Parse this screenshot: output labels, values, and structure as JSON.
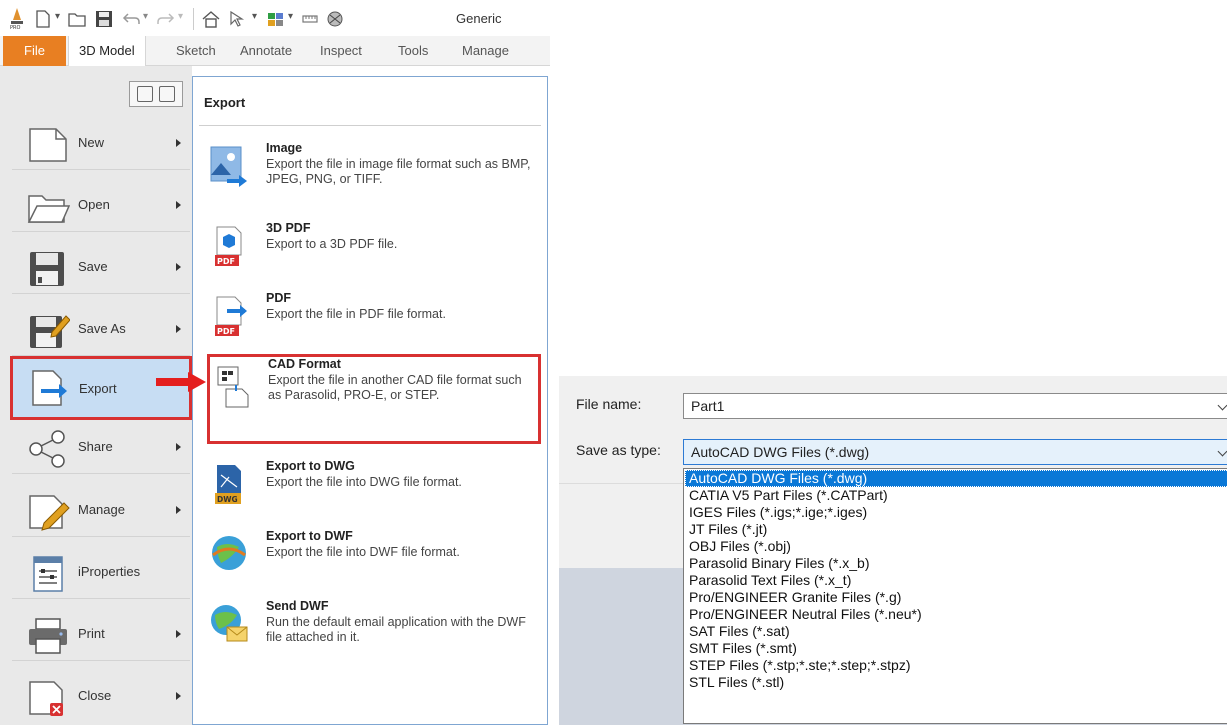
{
  "inventor": {
    "qat_profile": "Generic",
    "ribbon_tabs": [
      "File",
      "3D Model",
      "Sketch",
      "Annotate",
      "Inspect",
      "Tools",
      "Manage"
    ],
    "menu_items": [
      {
        "label": "New",
        "icon": "new-document-icon"
      },
      {
        "label": "Open",
        "icon": "open-folder-icon"
      },
      {
        "label": "Save",
        "icon": "floppy-disk-icon"
      },
      {
        "label": "Save As",
        "icon": "save-as-icon"
      },
      {
        "label": "Export",
        "icon": "export-icon"
      },
      {
        "label": "Share",
        "icon": "share-icon"
      },
      {
        "label": "Manage",
        "icon": "manage-icon"
      },
      {
        "label": "iProperties",
        "icon": "iproperties-icon"
      },
      {
        "label": "Print",
        "icon": "printer-icon"
      },
      {
        "label": "Close",
        "icon": "close-document-icon"
      }
    ],
    "export_panel": {
      "title": "Export",
      "items": [
        {
          "title": "Image",
          "desc": "Export the file in image file format such as BMP, JPEG, PNG, or TIFF.",
          "icon": "image-export-icon"
        },
        {
          "title": "3D PDF",
          "desc": "Export to a 3D PDF file.",
          "icon": "3d-pdf-icon"
        },
        {
          "title": "PDF",
          "desc": "Export the file in PDF file format.",
          "icon": "pdf-icon"
        },
        {
          "title": "CAD Format",
          "desc": "Export the file in another CAD file format such as Parasolid, PRO-E, or STEP.",
          "icon": "cad-format-icon"
        },
        {
          "title": "Export to DWG",
          "desc": "Export the file into DWG file format.",
          "icon": "dwg-icon"
        },
        {
          "title": "Export to DWF",
          "desc": "Export the file into DWF file format.",
          "icon": "dwf-globe-icon"
        },
        {
          "title": "Send DWF",
          "desc": "Run the default email application with the DWF file attached in it.",
          "icon": "send-dwf-icon"
        }
      ]
    },
    "colors": {
      "file_tab": "#e87f22",
      "highlight": "#d83131",
      "selected_bg": "#c7ddf3"
    }
  },
  "dialog": {
    "file_name_label": "File name:",
    "file_name_value": "Part1",
    "save_as_type_label": "Save as type:",
    "save_as_type_value": "AutoCAD DWG Files (*.dwg)",
    "options": [
      "AutoCAD DWG Files (*.dwg)",
      "CATIA V5 Part Files (*.CATPart)",
      "IGES Files (*.igs;*.ige;*.iges)",
      "JT Files (*.jt)",
      "OBJ Files (*.obj)",
      "Parasolid Binary Files (*.x_b)",
      "Parasolid Text Files (*.x_t)",
      "Pro/ENGINEER Granite Files (*.g)",
      "Pro/ENGINEER Neutral Files (*.neu*)",
      "SAT Files (*.sat)",
      "SMT Files (*.smt)",
      "STEP Files (*.stp;*.ste;*.step;*.stpz)",
      "STL Files (*.stl)"
    ],
    "selected_index": 0,
    "colors": {
      "selection": "#0a78d7"
    }
  }
}
